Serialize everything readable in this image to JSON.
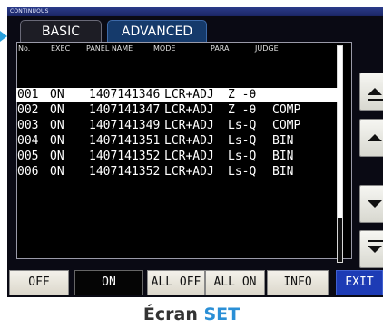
{
  "window": {
    "title": "CONTINUOUS"
  },
  "tabs": [
    {
      "label": "BASIC",
      "active": true
    },
    {
      "label": "ADVANCED",
      "active": false
    }
  ],
  "table": {
    "headers": [
      "No.",
      "EXEC",
      "PANEL NAME",
      "MODE",
      "PARA",
      "JUDGE"
    ],
    "rows": [
      {
        "no": "001",
        "exec": "ON",
        "panel": "1407141346",
        "mode": "LCR+ADJ",
        "para": "Z -θ",
        "judge": "",
        "selected": true
      },
      {
        "no": "002",
        "exec": "ON",
        "panel": "1407141347",
        "mode": "LCR+ADJ",
        "para": "Z -θ",
        "judge": "COMP"
      },
      {
        "no": "003",
        "exec": "ON",
        "panel": "1407141349",
        "mode": "LCR+ADJ",
        "para": "Ls-Q",
        "judge": "COMP"
      },
      {
        "no": "004",
        "exec": "ON",
        "panel": "1407141351",
        "mode": "LCR+ADJ",
        "para": "Ls-Q",
        "judge": "BIN"
      },
      {
        "no": "005",
        "exec": "ON",
        "panel": "1407141352",
        "mode": "LCR+ADJ",
        "para": "Ls-Q",
        "judge": "BIN"
      },
      {
        "no": "006",
        "exec": "ON",
        "panel": "1407141352",
        "mode": "LCR+ADJ",
        "para": "Ls-Q",
        "judge": "BIN"
      }
    ]
  },
  "side_buttons": [
    {
      "icon": "scroll-top-icon"
    },
    {
      "icon": "page-up-icon"
    },
    {
      "icon": "page-down-icon"
    },
    {
      "icon": "scroll-bottom-icon"
    }
  ],
  "bottom_buttons": {
    "off": "OFF",
    "on": "ON",
    "all_off": "ALL OFF",
    "all_on": "ALL ON",
    "info": "INFO",
    "exit": "EXIT"
  },
  "caption": {
    "prefix": "Écran",
    "accent": "SET"
  },
  "colors": {
    "accent": "#2a8fd6",
    "exit": "#1d3bb5",
    "tab_advanced": "#153a6b"
  }
}
